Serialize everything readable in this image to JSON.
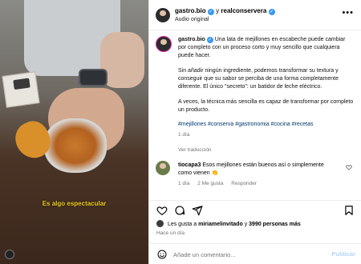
{
  "video": {
    "caption": "Es algo espectacular"
  },
  "header": {
    "author": "gastro.bio",
    "separator": "y",
    "coauthor": "realconservera",
    "audio": "Audio original",
    "more_icon": "more-horizontal-icon"
  },
  "post": {
    "author": "gastro.bio",
    "paragraph1": "Una lata de mejillones en escabeche puede cambiar por completo con un proceso corto y muy sencillo que cualquiera puede hacer.",
    "paragraph2": "Sin añadir ningún ingrediente, podemos transformar su textura y conseguir que su sabor se perciba de una forma completamente diferente. El único \"secreto\": un batidor de leche eléctrico.",
    "paragraph3": "A veces, la técnica más sencilla es capaz de transformar por completo un producto.",
    "hashtags": "#mejillones #conserva #gastronomia #cocina #recetas",
    "time": "1 día",
    "translate": "Ver traducción"
  },
  "comment": {
    "user": "tiocapa3",
    "text": "Esos mejillones están buenos así o simplemente como vienen 👏",
    "time": "1 día",
    "likes": "2 Me gusta",
    "reply": "Responder"
  },
  "actions": {
    "like_icon": "heart-icon",
    "comment_icon": "comment-icon",
    "share_icon": "send-icon",
    "save_icon": "bookmark-icon"
  },
  "likes_line": {
    "prefix": "Les gusta a",
    "user": "miriamelinvitado",
    "middle": "y",
    "count": "3990 personas más"
  },
  "ago": "Hace un día",
  "composer": {
    "placeholder": "Añade un comentario...",
    "publish": "Publicar",
    "emoji_icon": "emoji-icon"
  },
  "colors": {
    "link": "#00376b",
    "verified": "#3897f0",
    "caption": "#f3d21f",
    "publish": "#b3d4f5"
  }
}
